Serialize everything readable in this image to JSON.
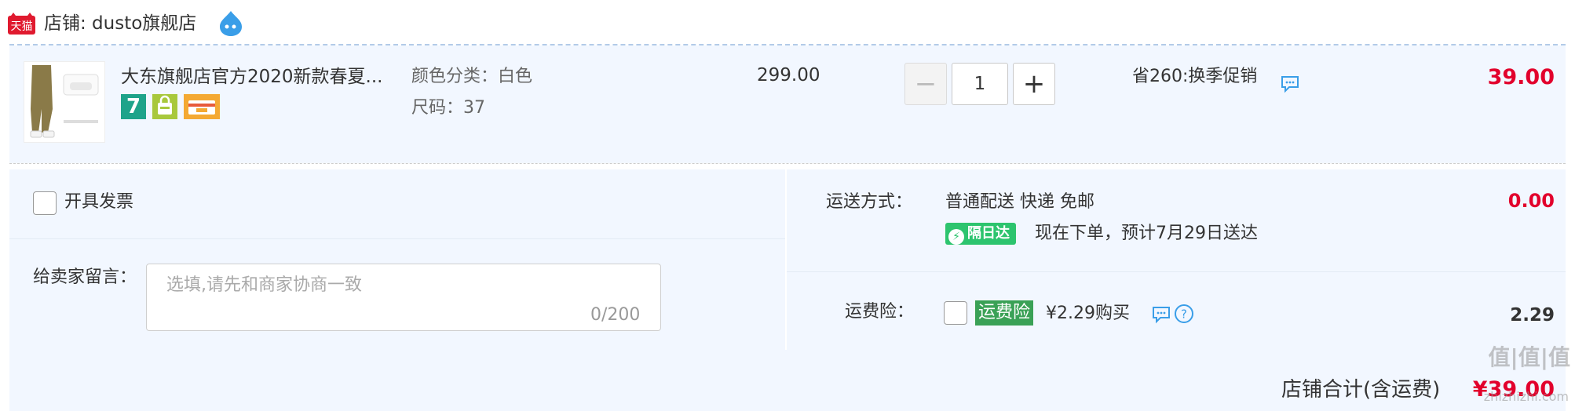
{
  "header": {
    "store_label": "店铺: dusto旗舰店",
    "logo_text": "天猫"
  },
  "item": {
    "title": "大东旗舰店官方2020新款春夏...",
    "badge_7": "7",
    "sku_color": "颜色分类：白色",
    "sku_size": "尺码：37",
    "unit_price": "299.00",
    "quantity": "1",
    "minus_symbol": "−",
    "plus_symbol": "+",
    "promo": "省260:换季促销",
    "subtotal": "39.00"
  },
  "invoice": {
    "label": "开具发票"
  },
  "message": {
    "label": "给卖家留言：",
    "placeholder": "选填,请先和商家协商一致",
    "counter": "0/200"
  },
  "shipping": {
    "label": "运送方式：",
    "method": "普通配送 快递 免邮",
    "fee": "0.00",
    "nextday_badge": "隔日达",
    "estimate": "现在下单，预计7月29日送达"
  },
  "insurance": {
    "label": "运费险：",
    "tag": "运费险",
    "price": "¥2.29购买",
    "fee": "2.29"
  },
  "footer": {
    "total_label": "店铺合计(含运费)",
    "total_amount": "¥39.00"
  },
  "watermark": {
    "text": "值|值|值",
    "sub": "zhizhizhi.com"
  },
  "colors": {
    "accent_red": "#e2002c",
    "panel_bg": "#f2f7ff",
    "nextday_green": "#2dc46e",
    "insurance_green": "#3aa156"
  },
  "icons": [
    "tmall-logo-icon",
    "wangwang-icon",
    "chat-icon",
    "help-icon",
    "bag-icon",
    "card-icon",
    "bolt-icon"
  ]
}
